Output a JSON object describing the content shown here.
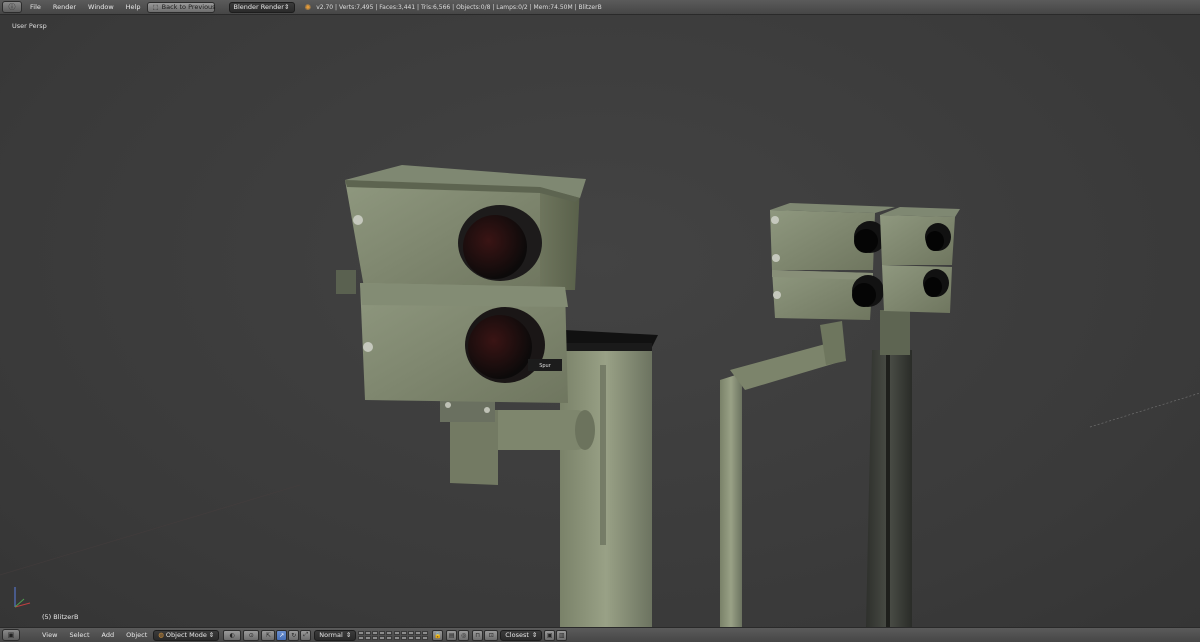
{
  "top_menu": {
    "items": [
      "File",
      "Render",
      "Window",
      "Help"
    ],
    "back_button": "Back to Previous",
    "render_engine": "Blender Render",
    "stats": "v2.70 | Verts:7,495 | Faces:3,441 | Tris:6,566 | Objects:0/8 | Lamps:0/2 | Mem:74.50M | BlitzerB"
  },
  "viewport": {
    "view_name": "User Persp",
    "active_object": "(5) BlitzerB"
  },
  "bottom_bar": {
    "menus": [
      "View",
      "Select",
      "Add",
      "Object"
    ],
    "mode": "Object Mode",
    "pivot": "Normal",
    "snap": "Closest"
  },
  "camera_label": "Spur",
  "colors": {
    "ui_header": "#4f4f4f",
    "viewport_bg": "#3d3d3d",
    "accent": "#5680c2",
    "camera_body": "#8a9378"
  }
}
